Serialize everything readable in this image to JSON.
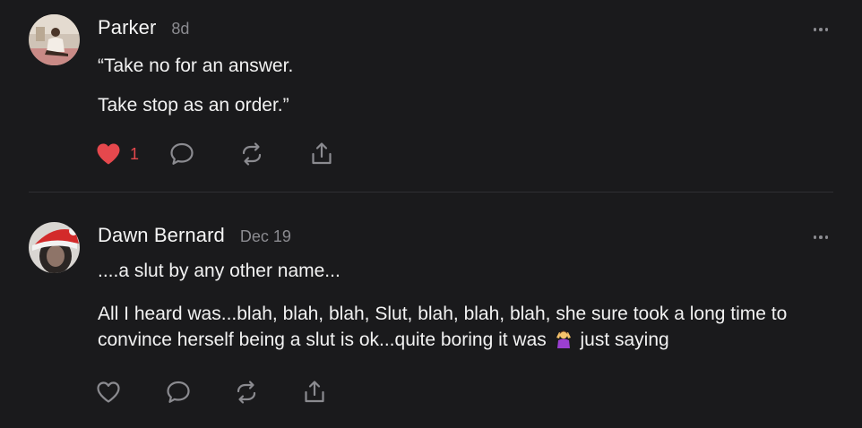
{
  "posts": [
    {
      "author": "Parker",
      "timestamp": "8d",
      "paragraphs": [
        "“Take no for an answer.",
        "Take stop as an order.”"
      ],
      "liked": true,
      "like_count": "1",
      "icons": [
        "heart-filled-icon",
        "comment-icon",
        "repost-icon",
        "share-icon",
        "more-icon"
      ]
    },
    {
      "author": "Dawn Bernard",
      "timestamp": "Dec 19",
      "paragraphs": [
        "....a slut by any other name...",
        "All I heard was...blah, blah, blah, Slut, blah, blah, blah, she sure took a long time to convince herself being a slut is ok...quite boring it was",
        "just saying"
      ],
      "emoji": "woman-shrugging-emoji",
      "liked": false,
      "icons": [
        "heart-outline-icon",
        "comment-icon",
        "repost-icon",
        "share-icon",
        "more-icon"
      ]
    }
  ],
  "colors": {
    "background": "#1a1a1c",
    "text": "#f2f2f2",
    "muted": "#8b8b90",
    "like": "#e5484d",
    "divider": "#2f2f33"
  }
}
